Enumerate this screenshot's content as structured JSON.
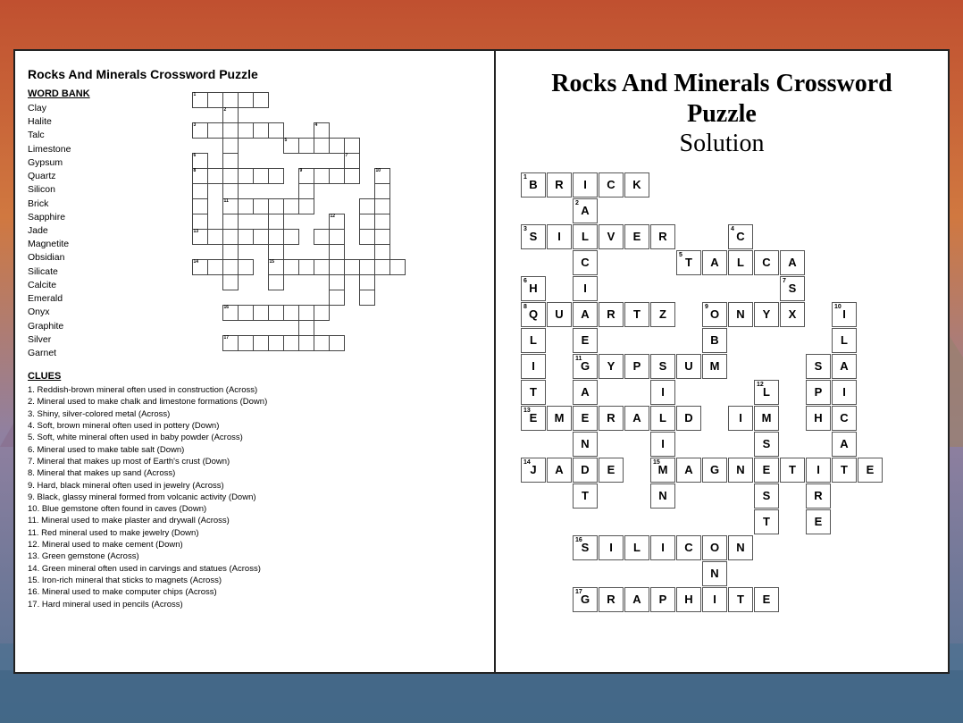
{
  "left": {
    "title": "Rocks And Minerals Crossword Puzzle",
    "word_bank_label": "WORD BANK",
    "words": [
      "Clay",
      "Halite",
      "Talc",
      "Limestone",
      "Gypsum",
      "Quartz",
      "Silicon",
      "Brick",
      "Sapphire",
      "Jade",
      "Magnetite",
      "Obsidian",
      "Silicate",
      "Calcite",
      "Emerald",
      "Onyx",
      "Graphite",
      "Silver",
      "Garnet"
    ],
    "clues_label": "CLUES",
    "clues": [
      "1. Reddish-brown mineral often used in construction (Across)",
      "2. Mineral used to make chalk and limestone formations (Down)",
      "3. Shiny, silver-colored metal (Across)",
      "4. Soft, brown mineral often used in pottery (Down)",
      "5. Soft, white mineral often used in baby powder (Across)",
      "6. Mineral used to make table salt (Down)",
      "7. Mineral that makes up most of Earth's crust (Down)",
      "8. Mineral that makes up sand (Across)",
      "9. Hard, black mineral often used in jewelry (Across)",
      "9. Black, glassy mineral formed from volcanic activity (Down)",
      "10. Blue gemstone often found in caves (Down)",
      "11. Mineral used to make plaster and drywall (Across)",
      "11. Red mineral used to make jewelry (Down)",
      "12. Mineral used to make cement (Down)",
      "13. Green gemstone (Across)",
      "14. Green mineral often used in carvings and statues (Across)",
      "15. Iron-rich mineral that sticks to magnets (Across)",
      "16. Mineral used to make computer chips (Across)",
      "17. Hard mineral used in pencils (Across)"
    ]
  },
  "right": {
    "title": "Rocks And Minerals Crossword Puzzle Solution",
    "solution_cells": [
      {
        "row": 0,
        "col": 0,
        "letter": "B",
        "num": "1"
      },
      {
        "row": 0,
        "col": 1,
        "letter": "R",
        "num": ""
      },
      {
        "row": 0,
        "col": 2,
        "letter": "I",
        "num": ""
      },
      {
        "row": 0,
        "col": 3,
        "letter": "C",
        "num": ""
      },
      {
        "row": 0,
        "col": 4,
        "letter": "K",
        "num": ""
      },
      {
        "row": 1,
        "col": 2,
        "letter": "A",
        "num": "2"
      },
      {
        "row": 2,
        "col": 0,
        "letter": "S",
        "num": "3"
      },
      {
        "row": 2,
        "col": 1,
        "letter": "I",
        "num": ""
      },
      {
        "row": 2,
        "col": 2,
        "letter": "L",
        "num": ""
      },
      {
        "row": 2,
        "col": 3,
        "letter": "V",
        "num": ""
      },
      {
        "row": 2,
        "col": 4,
        "letter": "E",
        "num": ""
      },
      {
        "row": 2,
        "col": 5,
        "letter": "R",
        "num": ""
      },
      {
        "row": 2,
        "col": 8,
        "letter": "C",
        "num": "4"
      },
      {
        "row": 3,
        "col": 2,
        "letter": "C",
        "num": ""
      },
      {
        "row": 3,
        "col": 6,
        "letter": "T",
        "num": "5"
      },
      {
        "row": 3,
        "col": 7,
        "letter": "A",
        "num": ""
      },
      {
        "row": 3,
        "col": 8,
        "letter": "L",
        "num": ""
      },
      {
        "row": 3,
        "col": 9,
        "letter": "C",
        "num": ""
      },
      {
        "row": 3,
        "col": 10,
        "letter": "A",
        "num": ""
      },
      {
        "row": 4,
        "col": 0,
        "letter": "H",
        "num": "6"
      },
      {
        "row": 4,
        "col": 2,
        "letter": "I",
        "num": ""
      },
      {
        "row": 4,
        "col": 10,
        "letter": "S",
        "num": "7"
      },
      {
        "row": 5,
        "col": 0,
        "letter": "Q",
        "num": "8"
      },
      {
        "row": 5,
        "col": 1,
        "letter": "U",
        "num": ""
      },
      {
        "row": 5,
        "col": 2,
        "letter": "A",
        "num": ""
      },
      {
        "row": 5,
        "col": 3,
        "letter": "R",
        "num": ""
      },
      {
        "row": 5,
        "col": 4,
        "letter": "T",
        "num": ""
      },
      {
        "row": 5,
        "col": 5,
        "letter": "Z",
        "num": ""
      },
      {
        "row": 5,
        "col": 7,
        "letter": "O",
        "num": "9"
      },
      {
        "row": 5,
        "col": 8,
        "letter": "N",
        "num": ""
      },
      {
        "row": 5,
        "col": 9,
        "letter": "Y",
        "num": ""
      },
      {
        "row": 5,
        "col": 10,
        "letter": "X",
        "num": ""
      },
      {
        "row": 5,
        "col": 12,
        "letter": "I",
        "num": "10"
      },
      {
        "row": 6,
        "col": 0,
        "letter": "L",
        "num": ""
      },
      {
        "row": 6,
        "col": 2,
        "letter": "E",
        "num": ""
      },
      {
        "row": 6,
        "col": 7,
        "letter": "B",
        "num": ""
      },
      {
        "row": 6,
        "col": 12,
        "letter": "L",
        "num": ""
      },
      {
        "row": 7,
        "col": 0,
        "letter": "I",
        "num": ""
      },
      {
        "row": 7,
        "col": 2,
        "letter": "G",
        "num": "11"
      },
      {
        "row": 7,
        "col": 3,
        "letter": "Y",
        "num": ""
      },
      {
        "row": 7,
        "col": 4,
        "letter": "P",
        "num": ""
      },
      {
        "row": 7,
        "col": 5,
        "letter": "S",
        "num": ""
      },
      {
        "row": 7,
        "col": 6,
        "letter": "U",
        "num": ""
      },
      {
        "row": 7,
        "col": 7,
        "letter": "M",
        "num": ""
      },
      {
        "row": 7,
        "col": 11,
        "letter": "S",
        "num": ""
      },
      {
        "row": 7,
        "col": 12,
        "letter": "A",
        "num": ""
      },
      {
        "row": 8,
        "col": 0,
        "letter": "T",
        "num": ""
      },
      {
        "row": 8,
        "col": 2,
        "letter": "A",
        "num": ""
      },
      {
        "row": 8,
        "col": 5,
        "letter": "I",
        "num": ""
      },
      {
        "row": 8,
        "col": 9,
        "letter": "L",
        "num": "12"
      },
      {
        "row": 8,
        "col": 11,
        "letter": "P",
        "num": ""
      },
      {
        "row": 8,
        "col": 12,
        "letter": "I",
        "num": ""
      },
      {
        "row": 9,
        "col": 0,
        "letter": "E",
        "num": "13"
      },
      {
        "row": 9,
        "col": 1,
        "letter": "M",
        "num": ""
      },
      {
        "row": 9,
        "col": 2,
        "letter": "E",
        "num": ""
      },
      {
        "row": 9,
        "col": 3,
        "letter": "R",
        "num": ""
      },
      {
        "row": 9,
        "col": 4,
        "letter": "A",
        "num": ""
      },
      {
        "row": 9,
        "col": 5,
        "letter": "L",
        "num": ""
      },
      {
        "row": 9,
        "col": 6,
        "letter": "D",
        "num": ""
      },
      {
        "row": 9,
        "col": 8,
        "letter": "I",
        "num": ""
      },
      {
        "row": 9,
        "col": 9,
        "letter": "M",
        "num": ""
      },
      {
        "row": 9,
        "col": 11,
        "letter": "H",
        "num": ""
      },
      {
        "row": 9,
        "col": 12,
        "letter": "C",
        "num": ""
      },
      {
        "row": 10,
        "col": 2,
        "letter": "N",
        "num": ""
      },
      {
        "row": 10,
        "col": 5,
        "letter": "I",
        "num": ""
      },
      {
        "row": 10,
        "col": 9,
        "letter": "S",
        "num": ""
      },
      {
        "row": 10,
        "col": 12,
        "letter": "A",
        "num": ""
      },
      {
        "row": 11,
        "col": 0,
        "letter": "J",
        "num": "14"
      },
      {
        "row": 11,
        "col": 1,
        "letter": "A",
        "num": ""
      },
      {
        "row": 11,
        "col": 2,
        "letter": "D",
        "num": ""
      },
      {
        "row": 11,
        "col": 3,
        "letter": "E",
        "num": ""
      },
      {
        "row": 11,
        "col": 5,
        "letter": "M",
        "num": "15"
      },
      {
        "row": 11,
        "col": 6,
        "letter": "A",
        "num": ""
      },
      {
        "row": 11,
        "col": 7,
        "letter": "G",
        "num": ""
      },
      {
        "row": 11,
        "col": 8,
        "letter": "N",
        "num": ""
      },
      {
        "row": 11,
        "col": 9,
        "letter": "E",
        "num": ""
      },
      {
        "row": 11,
        "col": 10,
        "letter": "T",
        "num": ""
      },
      {
        "row": 11,
        "col": 11,
        "letter": "I",
        "num": ""
      },
      {
        "row": 11,
        "col": 12,
        "letter": "T",
        "num": ""
      },
      {
        "row": 11,
        "col": 13,
        "letter": "E",
        "num": ""
      },
      {
        "row": 12,
        "col": 2,
        "letter": "T",
        "num": ""
      },
      {
        "row": 12,
        "col": 5,
        "letter": "N",
        "num": ""
      },
      {
        "row": 12,
        "col": 9,
        "letter": "S",
        "num": ""
      },
      {
        "row": 12,
        "col": 11,
        "letter": "R",
        "num": ""
      },
      {
        "row": 13,
        "col": 9,
        "letter": "T",
        "num": ""
      },
      {
        "row": 13,
        "col": 11,
        "letter": "E",
        "num": ""
      },
      {
        "row": 14,
        "col": 2,
        "letter": "S",
        "num": "16"
      },
      {
        "row": 14,
        "col": 3,
        "letter": "I",
        "num": ""
      },
      {
        "row": 14,
        "col": 4,
        "letter": "L",
        "num": ""
      },
      {
        "row": 14,
        "col": 5,
        "letter": "I",
        "num": ""
      },
      {
        "row": 14,
        "col": 6,
        "letter": "C",
        "num": ""
      },
      {
        "row": 14,
        "col": 7,
        "letter": "O",
        "num": ""
      },
      {
        "row": 14,
        "col": 8,
        "letter": "N",
        "num": ""
      },
      {
        "row": 15,
        "col": 7,
        "letter": "N",
        "num": ""
      },
      {
        "row": 16,
        "col": 2,
        "letter": "G",
        "num": "17"
      },
      {
        "row": 16,
        "col": 3,
        "letter": "R",
        "num": ""
      },
      {
        "row": 16,
        "col": 4,
        "letter": "A",
        "num": ""
      },
      {
        "row": 16,
        "col": 5,
        "letter": "P",
        "num": ""
      },
      {
        "row": 16,
        "col": 6,
        "letter": "H",
        "num": ""
      },
      {
        "row": 16,
        "col": 7,
        "letter": "I",
        "num": ""
      },
      {
        "row": 16,
        "col": 8,
        "letter": "T",
        "num": ""
      },
      {
        "row": 16,
        "col": 9,
        "letter": "E",
        "num": ""
      }
    ]
  }
}
